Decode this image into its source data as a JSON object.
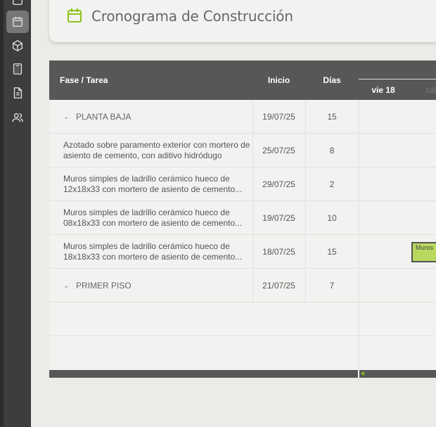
{
  "header": {
    "title": "Cronograma de Construcción",
    "icon": "calendar-icon"
  },
  "sidebar": {
    "items": [
      {
        "icon": "square-icon"
      },
      {
        "icon": "calendar-icon",
        "active": true
      },
      {
        "icon": "box-icon"
      },
      {
        "icon": "calculator-icon"
      },
      {
        "icon": "document-icon"
      },
      {
        "icon": "users-icon"
      }
    ]
  },
  "table": {
    "columns": {
      "task": "Fase / Tarea",
      "start": "Inicio",
      "days": "Días"
    },
    "gantt_days": [
      {
        "label": "vie 18"
      },
      {
        "label": "sáb"
      }
    ],
    "rows": [
      {
        "type": "phase",
        "name": "PLANTA BAJA",
        "start": "19/07/25",
        "days": "15"
      },
      {
        "type": "task",
        "name": "Azotado sobre paramento exterior con mortero de asiento de cemento, con aditivo hidródugo",
        "start": "25/07/25",
        "days": "8"
      },
      {
        "type": "task",
        "name": "Muros simples de ladrillo cerámico hueco de 12x18x33 con mortero de asiento de cemento...",
        "start": "29/07/25",
        "days": "2"
      },
      {
        "type": "task",
        "name": "Muros simples de ladrillo cerámico hueco de 08x18x33 con mortero de asiento de cemento...",
        "start": "19/07/25",
        "days": "10"
      },
      {
        "type": "task",
        "name": "Muros simples de ladrillo cerámico hueco de 18x18x33 con mortero de asiento de cemento...",
        "start": "18/07/25",
        "days": "15",
        "bar_label": "Muros"
      },
      {
        "type": "phase",
        "name": "PRIMER PISO",
        "start": "21/07/25",
        "days": "7"
      }
    ]
  },
  "colors": {
    "accent": "#8cc21a",
    "bar": "#b9d85f",
    "header_bg": "#575757",
    "sidebar": "#3d3d3d"
  }
}
